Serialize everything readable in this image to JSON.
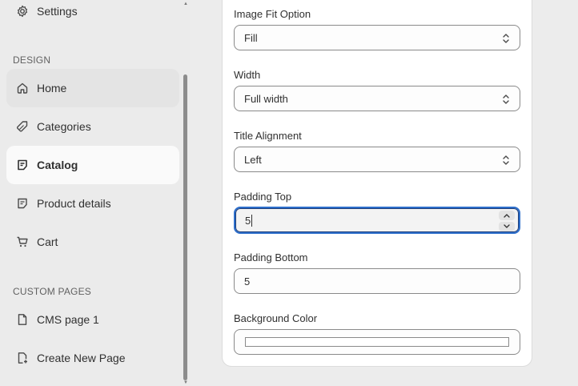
{
  "sidebar": {
    "settings_label": "Settings",
    "design_section": "DESIGN",
    "design_items": [
      {
        "label": "Home",
        "icon": "home-icon"
      },
      {
        "label": "Categories",
        "icon": "tag-icon"
      },
      {
        "label": "Catalog",
        "icon": "note-icon"
      },
      {
        "label": "Product details",
        "icon": "note-icon"
      },
      {
        "label": "Cart",
        "icon": "cart-icon"
      }
    ],
    "custom_section": "CUSTOM PAGES",
    "custom_items": [
      {
        "label": "CMS page 1",
        "icon": "page-icon"
      },
      {
        "label": "Create New Page",
        "icon": "page-add-icon"
      }
    ]
  },
  "form": {
    "image_fit": {
      "label": "Image Fit Option",
      "value": "Fill"
    },
    "width": {
      "label": "Width",
      "value": "Full width"
    },
    "title_alignment": {
      "label": "Title Alignment",
      "value": "Left"
    },
    "padding_top": {
      "label": "Padding Top",
      "value": "5"
    },
    "padding_bottom": {
      "label": "Padding Bottom",
      "value": "5"
    },
    "background_color": {
      "label": "Background Color",
      "value": "#ffffff"
    }
  },
  "colors": {
    "focus_ring": "#2c6ecb",
    "sidebar_bg": "#ebebeb",
    "active_item_bg": "#fafafa"
  }
}
